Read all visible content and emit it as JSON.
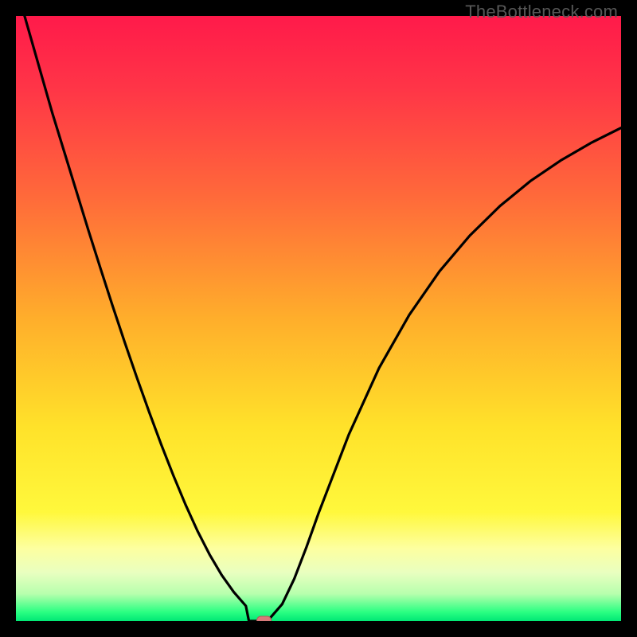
{
  "watermark": "TheBottleneck.com",
  "colors": {
    "background": "#000000",
    "curve": "#000000",
    "marker_fill": "#d77a7a",
    "marker_stroke": "#b55a5a",
    "gradient_stops": [
      {
        "offset": 0.0,
        "color": "#ff1a4a"
      },
      {
        "offset": 0.12,
        "color": "#ff3547"
      },
      {
        "offset": 0.3,
        "color": "#ff6a3a"
      },
      {
        "offset": 0.5,
        "color": "#ffae2b"
      },
      {
        "offset": 0.68,
        "color": "#ffe22a"
      },
      {
        "offset": 0.82,
        "color": "#fff83c"
      },
      {
        "offset": 0.88,
        "color": "#fdffa0"
      },
      {
        "offset": 0.92,
        "color": "#e9ffc0"
      },
      {
        "offset": 0.955,
        "color": "#b7ffad"
      },
      {
        "offset": 0.985,
        "color": "#2bff82"
      },
      {
        "offset": 1.0,
        "color": "#00e875"
      }
    ]
  },
  "chart_data": {
    "type": "line",
    "title": "",
    "xlabel": "",
    "ylabel": "",
    "x": [
      0.0,
      0.02,
      0.04,
      0.06,
      0.08,
      0.1,
      0.12,
      0.14,
      0.16,
      0.18,
      0.2,
      0.22,
      0.24,
      0.26,
      0.28,
      0.3,
      0.32,
      0.34,
      0.36,
      0.38,
      0.4,
      0.405,
      0.41,
      0.42,
      0.44,
      0.46,
      0.48,
      0.5,
      0.55,
      0.6,
      0.65,
      0.7,
      0.75,
      0.8,
      0.85,
      0.9,
      0.95,
      1.0
    ],
    "y": [
      1.05,
      0.98,
      0.91,
      0.84,
      0.775,
      0.71,
      0.645,
      0.582,
      0.52,
      0.46,
      0.402,
      0.346,
      0.292,
      0.241,
      0.193,
      0.149,
      0.11,
      0.076,
      0.048,
      0.025,
      0.008,
      0.003,
      0.0,
      0.005,
      0.028,
      0.07,
      0.122,
      0.178,
      0.308,
      0.418,
      0.506,
      0.578,
      0.637,
      0.686,
      0.727,
      0.761,
      0.79,
      0.815
    ],
    "xlim": [
      0,
      1
    ],
    "ylim": [
      0,
      1
    ],
    "marker": {
      "x": 0.41,
      "y": 0.0
    },
    "flat_bottom_range": [
      0.385,
      0.41
    ]
  }
}
